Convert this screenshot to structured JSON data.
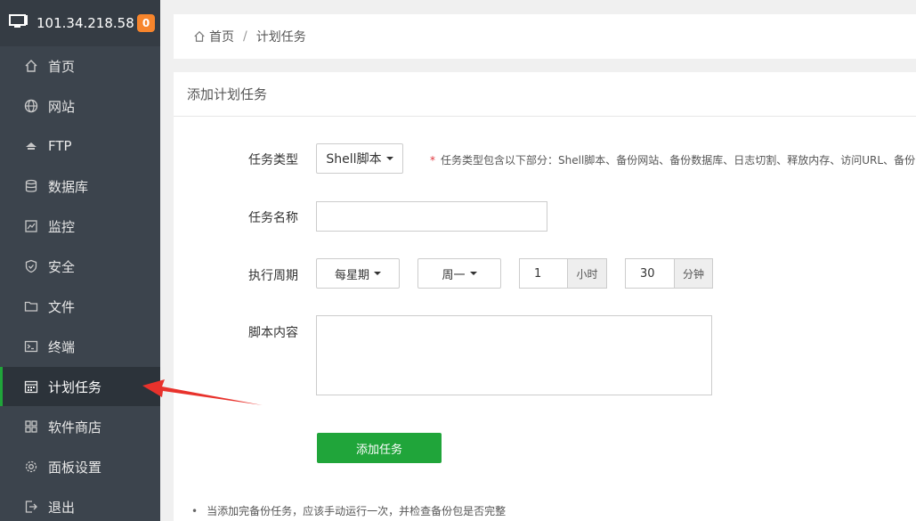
{
  "sidebar": {
    "server_ip": "101.34.218.58",
    "badge_count": "0",
    "items": [
      {
        "label": "首页",
        "icon": "home-icon"
      },
      {
        "label": "网站",
        "icon": "globe-icon"
      },
      {
        "label": "FTP",
        "icon": "ftp-icon"
      },
      {
        "label": "数据库",
        "icon": "database-icon"
      },
      {
        "label": "监控",
        "icon": "monitor-icon"
      },
      {
        "label": "安全",
        "icon": "shield-icon"
      },
      {
        "label": "文件",
        "icon": "folder-icon"
      },
      {
        "label": "终端",
        "icon": "terminal-icon"
      },
      {
        "label": "计划任务",
        "icon": "calendar-icon"
      },
      {
        "label": "软件商店",
        "icon": "apps-grid-icon"
      },
      {
        "label": "面板设置",
        "icon": "gear-icon"
      },
      {
        "label": "退出",
        "icon": "logout-icon"
      }
    ]
  },
  "breadcrumb": {
    "home": "首页",
    "sep": "/",
    "current": "计划任务"
  },
  "panel": {
    "title": "添加计划任务",
    "task_type": {
      "label": "任务类型",
      "value": "Shell脚本",
      "hint_star": "*",
      "hint": "任务类型包含以下部分：Shell脚本、备份网站、备份数据库、日志切割、释放内存、访问URL、备份"
    },
    "task_name": {
      "label": "任务名称",
      "value": ""
    },
    "period": {
      "label": "执行周期",
      "cycle": "每星期",
      "weekday": "周一",
      "hour": "1",
      "hour_unit": "小时",
      "minute": "30",
      "minute_unit": "分钟"
    },
    "script": {
      "label": "脚本内容",
      "value": ""
    },
    "submit_label": "添加任务",
    "note": "当添加完备份任务，应该手动运行一次，并检查备份包是否完整"
  },
  "colors": {
    "accent": "#20a53a",
    "sidebar_bg": "#3c444d",
    "badge": "#f7852c",
    "arrow": "#e8322c"
  }
}
